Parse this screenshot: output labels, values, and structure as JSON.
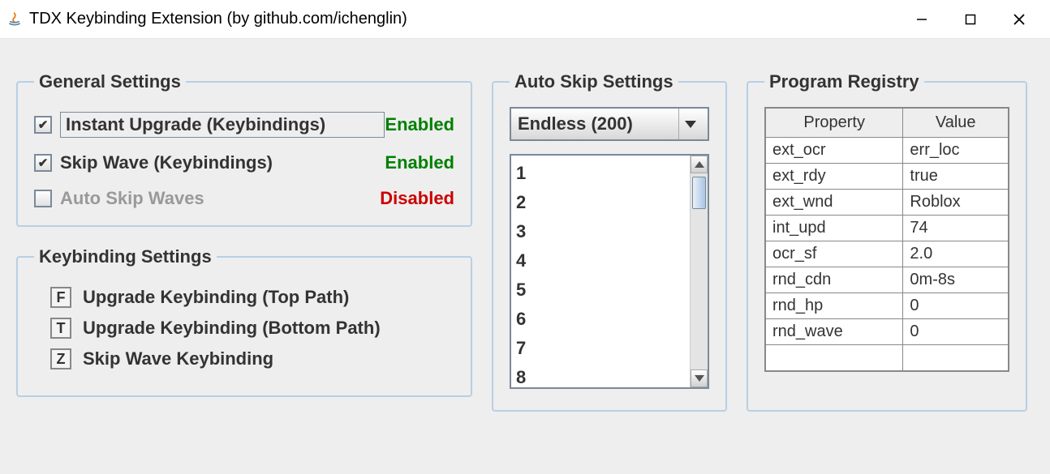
{
  "window": {
    "title": "TDX Keybinding Extension (by github.com/ichenglin)"
  },
  "general": {
    "legend": "General Settings",
    "items": [
      {
        "label": "Instant Upgrade (Keybindings)",
        "checked": true,
        "focused": true,
        "status": "Enabled",
        "enabled": true
      },
      {
        "label": "Skip Wave (Keybindings)",
        "checked": true,
        "focused": false,
        "status": "Enabled",
        "enabled": true
      },
      {
        "label": "Auto Skip Waves",
        "checked": false,
        "focused": false,
        "status": "Disabled",
        "enabled": false
      }
    ]
  },
  "keybinding": {
    "legend": "Keybinding Settings",
    "items": [
      {
        "key": "F",
        "label": "Upgrade Keybinding (Top Path)"
      },
      {
        "key": "T",
        "label": "Upgrade Keybinding (Bottom Path)"
      },
      {
        "key": "Z",
        "label": "Skip Wave Keybinding"
      }
    ]
  },
  "autoskip": {
    "legend": "Auto Skip Settings",
    "dropdown": "Endless (200)",
    "list": [
      "1",
      "2",
      "3",
      "4",
      "5",
      "6",
      "7",
      "8"
    ]
  },
  "registry": {
    "legend": "Program Registry",
    "headers": [
      "Property",
      "Value"
    ],
    "rows": [
      {
        "k": "ext_ocr",
        "v": "err_loc"
      },
      {
        "k": "ext_rdy",
        "v": "true"
      },
      {
        "k": "ext_wnd",
        "v": "Roblox"
      },
      {
        "k": "int_upd",
        "v": "74"
      },
      {
        "k": "ocr_sf",
        "v": "2.0"
      },
      {
        "k": "rnd_cdn",
        "v": "0m-8s"
      },
      {
        "k": "rnd_hp",
        "v": "0"
      },
      {
        "k": "rnd_wave",
        "v": "0"
      }
    ]
  }
}
